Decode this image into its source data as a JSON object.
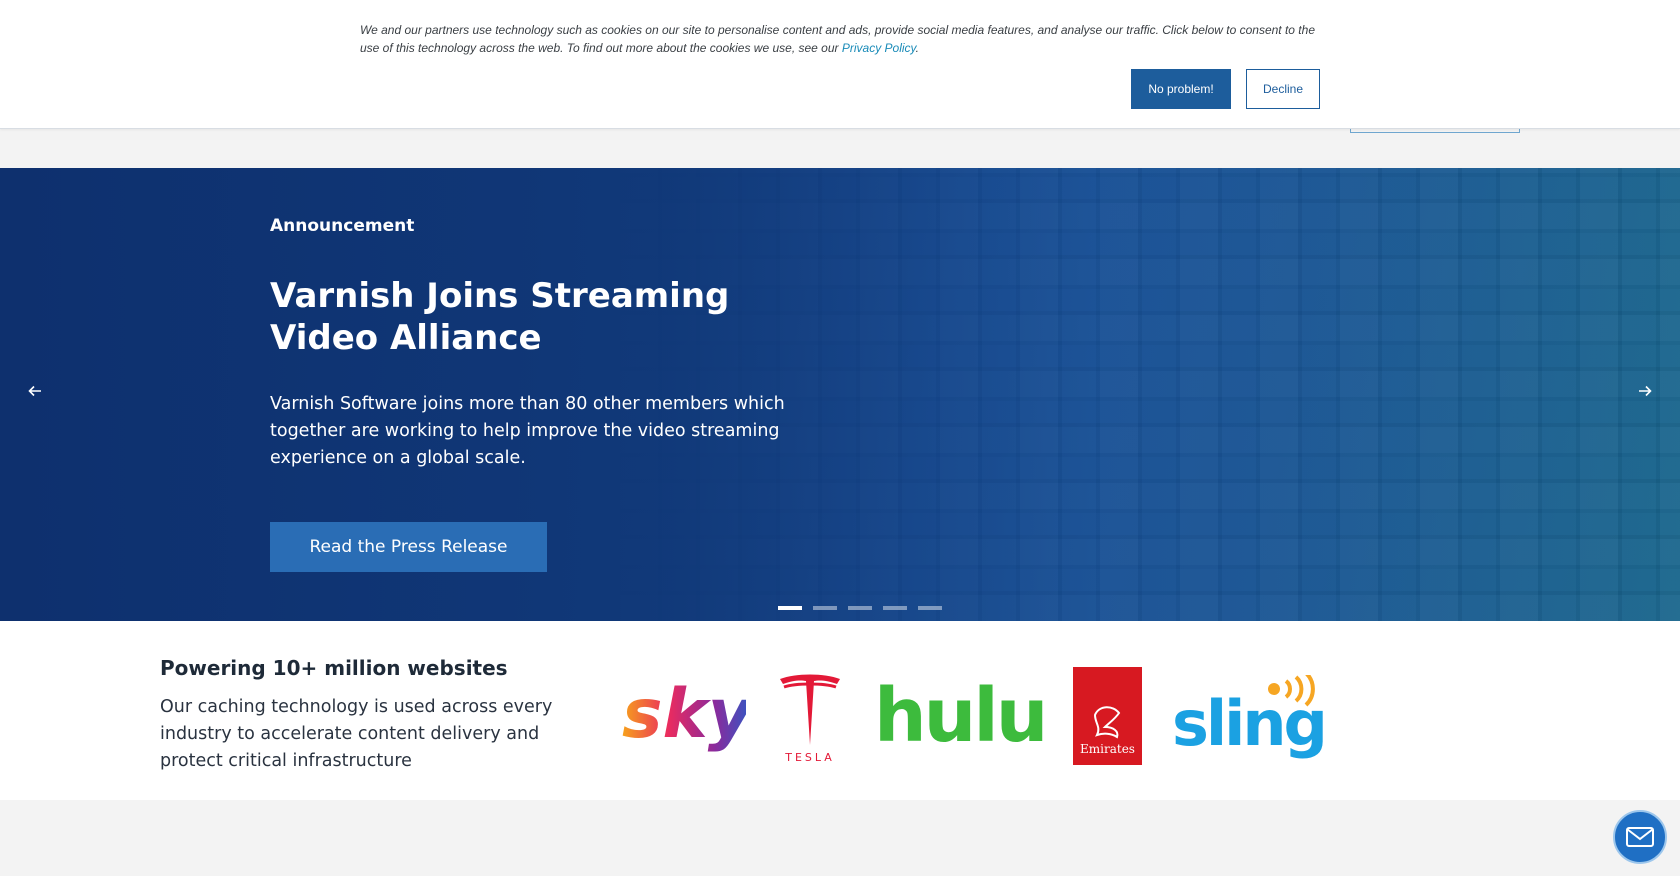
{
  "cookie_banner": {
    "text": "We and our partners use technology such as cookies on our site to personalise content and ads, provide social media features, and analyse our traffic. Click below to consent to the use of this technology across the web. To find out more about the cookies we use, see our",
    "link_label": "Privacy Policy",
    "link_suffix": ".",
    "accept_label": "No problem!",
    "decline_label": "Decline"
  },
  "hero": {
    "kicker": "Announcement",
    "title": "Varnish Joins Streaming Video Alliance",
    "description": "Varnish Software joins more than 80 other members which together are working to help improve the video streaming experience on a global scale.",
    "cta_label": "Read the Press Release",
    "prev_icon": "arrow-left-icon",
    "next_icon": "arrow-right-icon",
    "slide_count": 5,
    "active_slide": 1
  },
  "trust": {
    "title": "Powering 10+ million websites",
    "description": "Our caching technology is used across every industry to accelerate content delivery and protect critical infrastructure",
    "logos": [
      {
        "name": "sky",
        "text": "sky"
      },
      {
        "name": "tesla",
        "text": "TESLA"
      },
      {
        "name": "hulu",
        "text": "hulu"
      },
      {
        "name": "emirates",
        "text": "Emirates"
      },
      {
        "name": "sling",
        "text": "sling"
      }
    ]
  },
  "chat": {
    "icon": "envelope-icon"
  },
  "colors": {
    "primary_blue": "#1d5d9c",
    "cta_blue": "#2a6db5",
    "hulu_green": "#3dbb3d",
    "tesla_red": "#e31937",
    "emirates_red": "#d71921",
    "sling_blue": "#1ba1e2",
    "sling_orange": "#f6a623"
  }
}
